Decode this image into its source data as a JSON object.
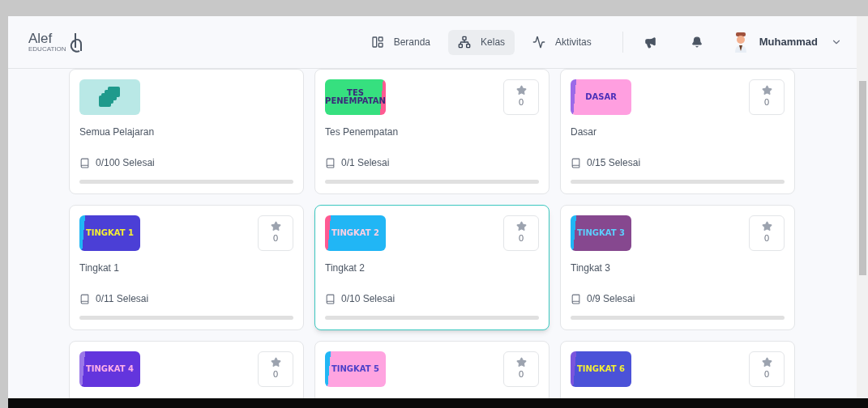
{
  "header": {
    "logo": {
      "name": "Alef",
      "tagline": "EDUCATION"
    },
    "nav": [
      {
        "label": "Beranda",
        "selected": false
      },
      {
        "label": "Kelas",
        "selected": true
      },
      {
        "label": "Aktivitas",
        "selected": false
      }
    ],
    "user": {
      "name": "Muhammad"
    }
  },
  "cards": [
    {
      "kind": "all",
      "title": "Semua Pelajaran",
      "progress": "0/100 Selesai",
      "selected": false
    },
    {
      "kind": "level",
      "thumb": "TES PENEMPATAN",
      "color": "#36e07f",
      "title": "Tes Penempatan",
      "stars": "0",
      "progress": "0/1 Selesai",
      "selected": false
    },
    {
      "kind": "level",
      "thumb": "DASAR",
      "color": "#ff9fe0",
      "title": "Dasar",
      "stars": "0",
      "progress": "0/15 Selesai",
      "selected": false
    },
    {
      "kind": "level",
      "thumb": "TINGKAT 1",
      "color": "#4b3fd6",
      "title": "Tingkat 1",
      "stars": "0",
      "progress": "0/11 Selesai",
      "selected": false
    },
    {
      "kind": "level",
      "thumb": "TINGKAT 2",
      "color": "#21b6f5",
      "title": "Tingkat 2",
      "stars": "0",
      "progress": "0/10 Selesai",
      "selected": true
    },
    {
      "kind": "level",
      "thumb": "TINGKAT 3",
      "color": "#86488f",
      "title": "Tingkat 3",
      "stars": "0",
      "progress": "0/9 Selesai",
      "selected": false
    },
    {
      "kind": "level",
      "thumb": "TINGKAT 4",
      "color": "#6335dd",
      "stars": "0",
      "selected": false
    },
    {
      "kind": "level",
      "thumb": "TINGKAT 5",
      "color": "#ffa4e0",
      "stars": "0",
      "selected": false
    },
    {
      "kind": "level",
      "thumb": "TINGKAT 6",
      "color": "#4b52d8",
      "stars": "0",
      "selected": false
    }
  ]
}
